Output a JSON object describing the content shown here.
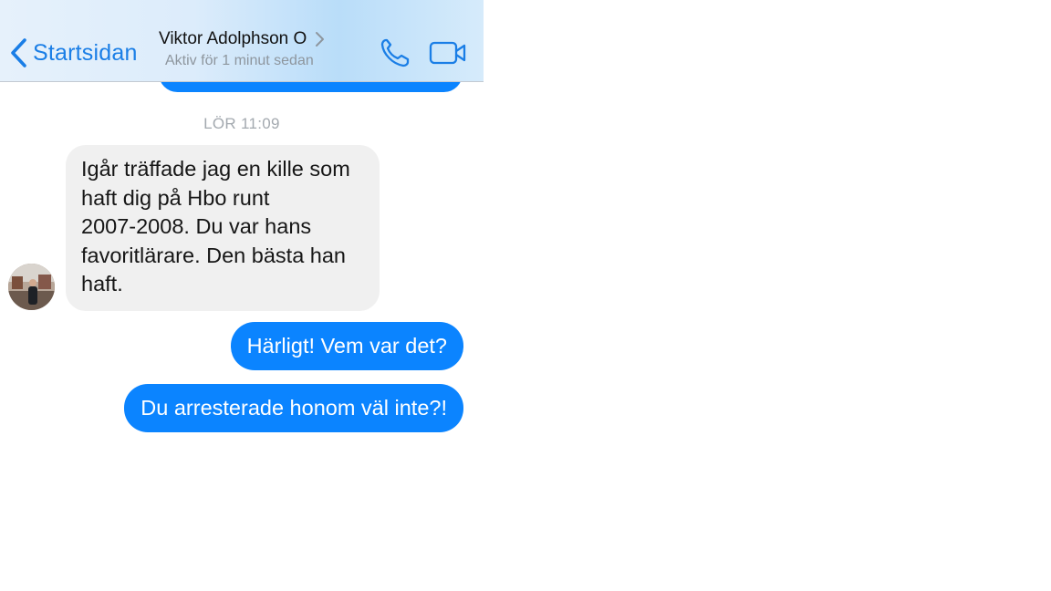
{
  "header": {
    "back_label": "Startsidan",
    "contact_name": "Viktor Adolphson O",
    "status": "Aktiv för 1 minut sedan"
  },
  "icons": {
    "back": "chevron-left-icon",
    "details": "chevron-right-icon",
    "call": "phone-icon",
    "video": "video-camera-icon"
  },
  "conversation": {
    "timestamp": "LÖR 11:09",
    "incoming": [
      {
        "lines": [
          "Igår träffade jag en kille som",
          "haft dig på Hbo runt",
          "2007-2008. Du var hans",
          "favoritlärare. Den bästa han",
          "haft."
        ]
      }
    ],
    "outgoing": [
      {
        "text": "Härligt! Vem var det?"
      },
      {
        "text": "Du arresterade honom väl inte?!"
      }
    ]
  },
  "colors": {
    "accent": "#1a7ee6",
    "outgoing_bubble": "#0b84ff",
    "incoming_bubble": "#f0f0f0",
    "muted_text": "#a3a9af"
  }
}
